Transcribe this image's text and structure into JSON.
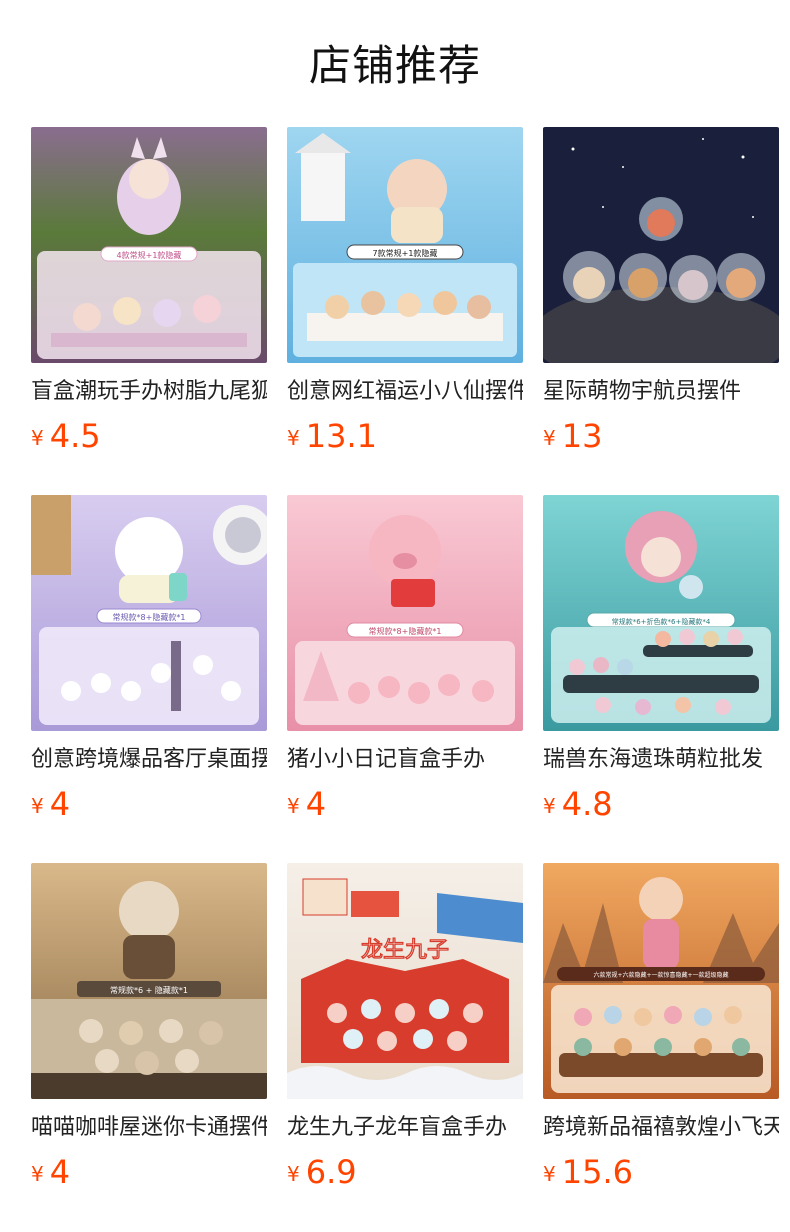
{
  "page": {
    "title": "店铺推荐"
  },
  "currency_symbol": "¥",
  "products": [
    {
      "name": "盲盒潮玩手办树脂九尾狐",
      "price": "4.5",
      "image_badge": "4款常规+1款隐藏",
      "colors": [
        "#d79fc4",
        "#5a7a3a",
        "#f4e6f1"
      ]
    },
    {
      "name": "创意网红福运小八仙摆件",
      "price": "13.1",
      "image_badge": "7款常规+1款隐藏",
      "colors": [
        "#7ec6ea",
        "#f0d9b0",
        "#ffffff"
      ]
    },
    {
      "name": "星际萌物宇航员摆件",
      "price": "13",
      "image_badge": "",
      "colors": [
        "#1a1f3b",
        "#3a3a44",
        "#e8d2b8"
      ]
    },
    {
      "name": "创意跨境爆品客厅桌面摆件",
      "price": "4",
      "image_badge": "常规款*8+隐藏款*1",
      "colors": [
        "#c8b8e8",
        "#efe9f9",
        "#8a7cc8"
      ]
    },
    {
      "name": "猪小小日记盲盒手办",
      "price": "4",
      "image_badge": "常规款*8+隐藏款*1",
      "colors": [
        "#f4b9c6",
        "#f8d6de",
        "#e28aa0"
      ]
    },
    {
      "name": "瑞兽东海遗珠萌粒批发",
      "price": "4.8",
      "image_badge": "常规款*6+折色款*6+隐藏款*4",
      "colors": [
        "#6cc9c9",
        "#2e3d44",
        "#f1c9d4"
      ]
    },
    {
      "name": "喵喵咖啡屋迷你卡通摆件",
      "price": "4",
      "image_badge": "常规款*6 + 隐藏款*1",
      "colors": [
        "#b88e5c",
        "#4a3b2c",
        "#e8d9c4"
      ]
    },
    {
      "name": "龙生九子龙年盲盒手办",
      "price": "6.9",
      "image_badge": "龙生九子",
      "colors": [
        "#d73c2c",
        "#f5efe8",
        "#4d8ccf"
      ]
    },
    {
      "name": "跨境新品福禧敦煌小飞天",
      "price": "15.6",
      "image_badge": "六款常规+六款隐藏+一款惊喜隐藏+一款超级隐藏",
      "colors": [
        "#e07a2c",
        "#7a4a2a",
        "#f4d2b8"
      ]
    }
  ]
}
